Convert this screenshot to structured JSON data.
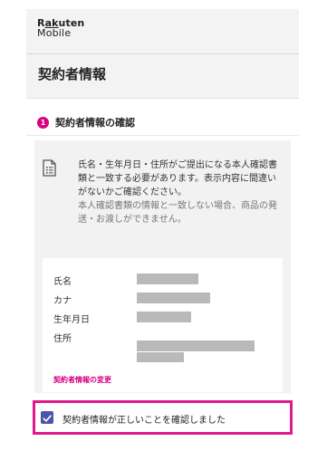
{
  "brand": {
    "line1_pre": "R",
    "line1_underlined": "ak",
    "line1_post": "uten",
    "line2": "Mobile"
  },
  "page": {
    "title": "契約者情報"
  },
  "step": {
    "number": "1",
    "title": "契約者情報の確認"
  },
  "notice": {
    "main": "氏名・生年月日・住所がご提出になる本人確認書類と一致する必要があります。表示内容に間違いがないかご確認ください。",
    "sub": "本人確認書類の情報と一致しない場合、商品の発送・お渡しができません。"
  },
  "info": {
    "name_label": "氏名",
    "kana_label": "カナ",
    "birthdate_label": "生年月日",
    "address_label": "住所",
    "change_link": "契約者情報の変更"
  },
  "confirm": {
    "label": "契約者情報が正しいことを確認しました",
    "checked": true
  },
  "colors": {
    "accent": "#d8007f",
    "checkbox": "#4a55a8",
    "highlight_border": "#e0198c"
  }
}
